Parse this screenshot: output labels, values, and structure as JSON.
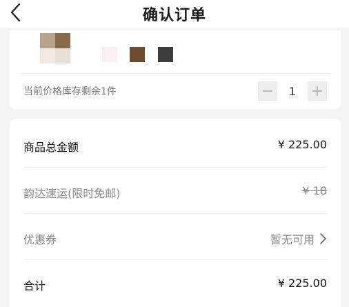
{
  "header": {
    "title": "确认订单"
  },
  "product": {
    "stock_note": "当前价格库存剩余1件",
    "quantity": "1",
    "swatch_colors": [
      "#6d4c2e",
      "#3c3c3c"
    ]
  },
  "summary": {
    "subtotal_label": "商品总金额",
    "subtotal_value": "¥ 225.00",
    "shipping_label": "韵达速运(限时免邮)",
    "shipping_value": "¥ 18",
    "coupon_label": "优惠券",
    "coupon_value": "暂无可用",
    "total_label": "合计",
    "total_value": "¥ 225.00"
  },
  "colors": {
    "page_bg": "#f4f4f4",
    "card_bg": "#ffffff",
    "muted_text": "#888888",
    "stepper_bg": "#ededed"
  }
}
